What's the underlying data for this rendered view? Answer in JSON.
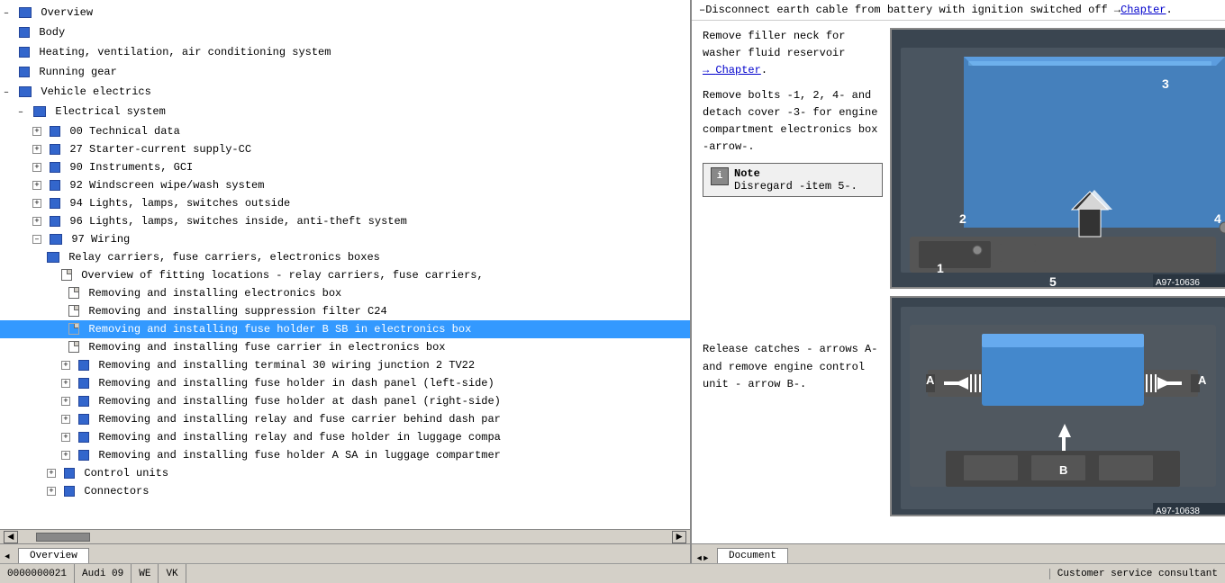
{
  "left_panel": {
    "tree_items": [
      {
        "id": "overview",
        "label": "Overview",
        "indent": 0,
        "type": "folder-open",
        "expanded": true
      },
      {
        "id": "body",
        "label": "Body",
        "indent": 0,
        "type": "blue-square",
        "expanded": false
      },
      {
        "id": "hvac",
        "label": "Heating, ventilation, air conditioning system",
        "indent": 0,
        "type": "blue-square",
        "expanded": false
      },
      {
        "id": "running",
        "label": "Running gear",
        "indent": 0,
        "type": "blue-square",
        "expanded": false
      },
      {
        "id": "electrics",
        "label": "Vehicle electrics",
        "indent": 0,
        "type": "folder-open",
        "expanded": true
      },
      {
        "id": "electrical",
        "label": "Electrical system",
        "indent": 1,
        "type": "folder-open",
        "expanded": true
      },
      {
        "id": "tech",
        "label": "00 Technical data",
        "indent": 2,
        "type": "blue-square-plus",
        "expanded": false
      },
      {
        "id": "starter",
        "label": "27 Starter-current supply-CC",
        "indent": 2,
        "type": "blue-square-plus",
        "expanded": false
      },
      {
        "id": "instruments",
        "label": "90 Instruments, GCI",
        "indent": 2,
        "type": "blue-square-plus",
        "expanded": false
      },
      {
        "id": "windscreen",
        "label": "92 Windscreen wipe/wash system",
        "indent": 2,
        "type": "blue-square-plus",
        "expanded": false
      },
      {
        "id": "lights94",
        "label": "94 Lights, lamps, switches outside",
        "indent": 2,
        "type": "blue-square-plus",
        "expanded": false
      },
      {
        "id": "lights96",
        "label": "96 Lights, lamps, switches inside, anti-theft system",
        "indent": 2,
        "type": "blue-square-plus",
        "expanded": false
      },
      {
        "id": "wiring97",
        "label": "97 Wiring",
        "indent": 2,
        "type": "folder-open-plus",
        "expanded": true
      },
      {
        "id": "relay",
        "label": "Relay carriers, fuse carriers, electronics boxes",
        "indent": 3,
        "type": "folder-open",
        "expanded": true
      },
      {
        "id": "overview-fitting",
        "label": "Overview of fitting locations - relay carriers, fuse carriers,",
        "indent": 4,
        "type": "doc",
        "expanded": false
      },
      {
        "id": "removing-elec",
        "label": "Removing and installing electronics box",
        "indent": 4,
        "type": "doc",
        "expanded": false
      },
      {
        "id": "removing-supp",
        "label": "Removing and installing suppression filter C24",
        "indent": 4,
        "type": "doc",
        "expanded": false
      },
      {
        "id": "removing-fuse-b",
        "label": "Removing and installing fuse holder B SB in electronics box",
        "indent": 4,
        "type": "doc",
        "selected": true,
        "expanded": false
      },
      {
        "id": "removing-fuse-c",
        "label": "Removing and installing fuse carrier in electronics box",
        "indent": 4,
        "type": "doc",
        "expanded": false
      },
      {
        "id": "removing-term",
        "label": "Removing and installing terminal 30 wiring junction 2 TV22",
        "indent": 4,
        "type": "blue-square-plus",
        "expanded": false
      },
      {
        "id": "removing-dash-l",
        "label": "Removing and installing fuse holder in dash panel (left-side)",
        "indent": 4,
        "type": "blue-square-plus",
        "expanded": false
      },
      {
        "id": "removing-dash-r",
        "label": "Removing and installing fuse holder at dash panel (right-side)",
        "indent": 4,
        "type": "blue-square-plus",
        "expanded": false
      },
      {
        "id": "removing-relay-dash",
        "label": "Removing and installing relay and fuse carrier behind dash par",
        "indent": 4,
        "type": "blue-square-plus",
        "expanded": false
      },
      {
        "id": "removing-relay-lug",
        "label": "Removing and installing relay and fuse holder in luggage compa",
        "indent": 4,
        "type": "blue-square-plus",
        "expanded": false
      },
      {
        "id": "removing-fuse-a",
        "label": "Removing and installing fuse holder A SA in luggage compartmer",
        "indent": 4,
        "type": "blue-square-plus",
        "expanded": false
      },
      {
        "id": "control",
        "label": "Control units",
        "indent": 3,
        "type": "blue-square-plus",
        "expanded": false
      },
      {
        "id": "connectors",
        "label": "Connectors",
        "indent": 3,
        "type": "blue-square-plus",
        "expanded": false
      }
    ]
  },
  "right_panel": {
    "header_text": "Disconnect earth cable from battery with ignition switched off",
    "chapter_link": "Chapter",
    "step1": {
      "text": "Remove filler neck for washer fluid reservoir",
      "chapter_link": "Chapter"
    },
    "step2": {
      "text": "Remove bolts -1, 2, 4- and detach cover -3- for engine compartment electronics box -arrow-."
    },
    "note": {
      "text": "Note",
      "detail": "Disregard -item 5-."
    },
    "step3": {
      "text": "Release catches - arrows A- and remove engine control unit - arrow B-."
    },
    "image1_label": "A97-10636",
    "image2_label": "A97-10638",
    "image1_numbers": [
      "1",
      "2",
      "3",
      "4",
      "5"
    ],
    "image2_labels": [
      "A",
      "A",
      "B"
    ]
  },
  "tabs": {
    "left_tab": "Overview",
    "right_tab": "Document"
  },
  "status_bar": {
    "left_text": "0000000021",
    "middle_text": "Audi 09",
    "right_items": [
      "WE",
      "VK"
    ],
    "far_right": "Customer service consultant"
  }
}
